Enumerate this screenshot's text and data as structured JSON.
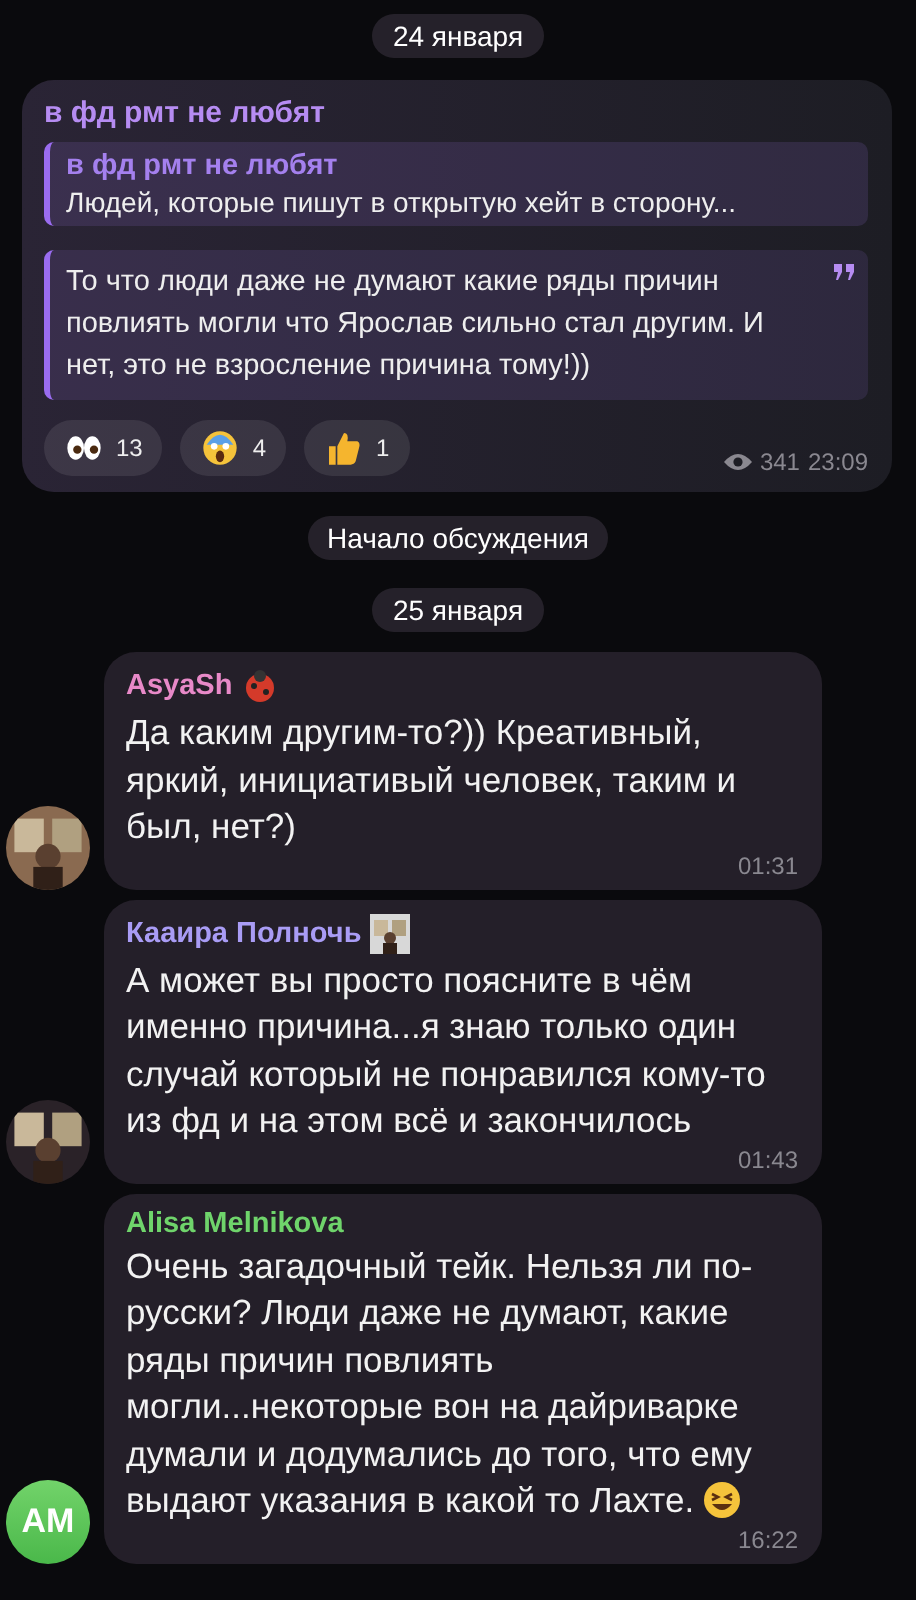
{
  "post": {
    "date": "24 января",
    "title": "в фд рмт не любят",
    "reply": {
      "author": "в фд рмт не любят",
      "text": "Людей, которые пишут в открытую хейт в сторону..."
    },
    "quote": "То что люди даже не думают какие ряды причин повлиять могли что Ярослав сильно стал другим. И нет, это не взросление причина тому!))",
    "reactions": [
      {
        "kind": "eyes",
        "count": "13"
      },
      {
        "kind": "scream",
        "count": "4"
      },
      {
        "kind": "thumbs",
        "count": "1"
      }
    ],
    "views": "341",
    "time": "23:09"
  },
  "service": "Начало обсуждения",
  "date": "25 января",
  "messages": [
    {
      "author": "AsyaSh",
      "color": "#e889c8",
      "badge": {
        "kind": "ladybug"
      },
      "text": "Да каким другим-то?)) Креативный, яркий, инициативый человек, таким и был, нет?)",
      "time": "01:31"
    },
    {
      "author": "Кааира Полночь",
      "color": "#a99cf5",
      "text": "А может вы просто поясните в чём именно причина...я знаю только один случай который не понравился кому-то из фд и на этом всё и закончилось",
      "time": "01:43"
    },
    {
      "author": "Alisa Melnikova",
      "color": "#6fd46b",
      "avatar": {
        "kind": "initials",
        "text": "AM"
      },
      "text": "Очень загадочный тейк. Нельзя ли по-русски? Люди даже не думают, какие ряды причин повлиять могли...некоторые вон на дайриварке думали и додумались до того, что ему выдают указания в какой то Лахте.",
      "emoji": {
        "kind": "grin"
      },
      "time": "16:22"
    }
  ]
}
